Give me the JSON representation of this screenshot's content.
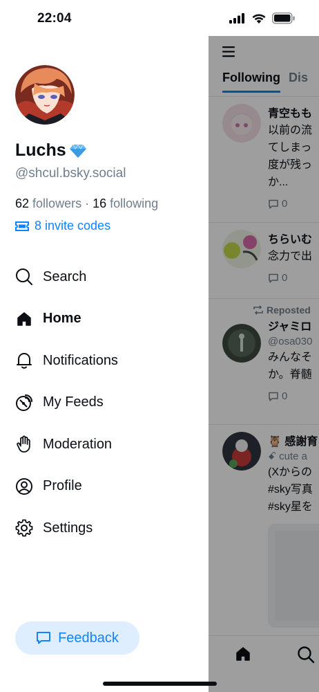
{
  "status_bar": {
    "time": "22:04"
  },
  "profile": {
    "display_name": "Luchs",
    "badge_icon": "diamond-icon",
    "handle": "@shcul.bsky.social",
    "followers_count": "62",
    "followers_label": "followers",
    "separator": "·",
    "following_count": "16",
    "following_label": "following",
    "invite_codes": "8 invite codes"
  },
  "nav": {
    "search": "Search",
    "home": "Home",
    "notifications": "Notifications",
    "my_feeds": "My Feeds",
    "moderation": "Moderation",
    "profile": "Profile",
    "settings": "Settings"
  },
  "feedback": {
    "label": "Feedback"
  },
  "feed": {
    "tabs": [
      "Following",
      "Dis"
    ],
    "posts": [
      {
        "author": "青空もも",
        "text": "以前の流\nてしまっ\n度が残っ\nか...",
        "replies": "0"
      },
      {
        "author": "ちらいむ",
        "text": "念力で出",
        "replies": "0"
      },
      {
        "repost_label": "Reposted",
        "author": "ジャミロ",
        "handle": "@osa030",
        "text": "みんなそ\nか。脊髄",
        "replies": "0"
      },
      {
        "author": "🦉 感謝育",
        "handle": "ꗃ cute a",
        "text": "(Xからの\n#sky写真\n#sky星を"
      }
    ]
  },
  "colors": {
    "accent": "#1083fe",
    "muted": "#6f7e8c",
    "feedback_bg": "#deeeff"
  }
}
